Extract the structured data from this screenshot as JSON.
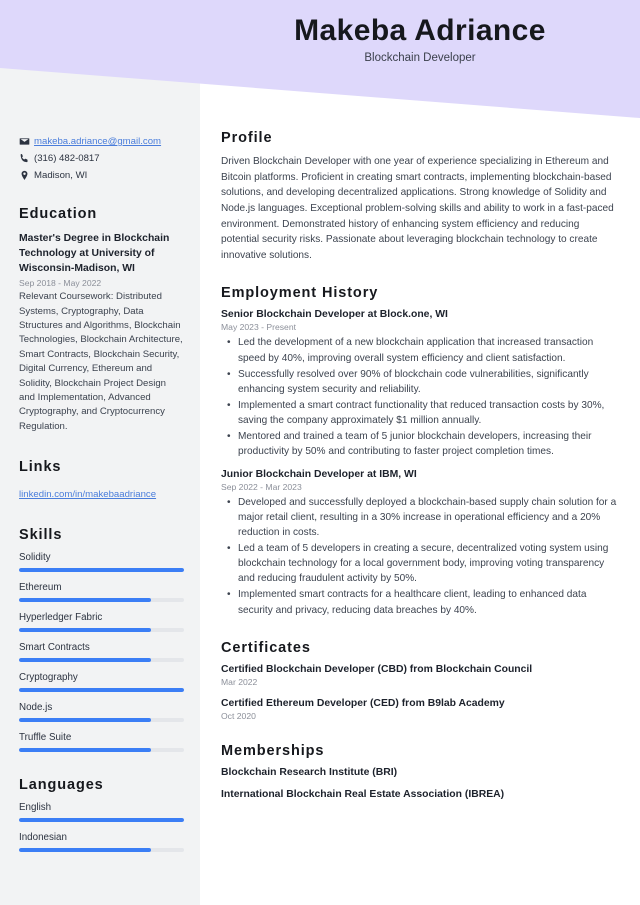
{
  "header": {
    "name": "Makeba Adriance",
    "role": "Blockchain Developer",
    "background_color": "#ded8fb"
  },
  "theme": {
    "sidebar_bg": "#f2f3f4",
    "accent": "#3b7ef5",
    "link_color": "#4a7ddb",
    "track_color": "#e4e6ea"
  },
  "sidebar": {
    "contact": {
      "email": "makeba.adriance@gmail.com",
      "phone": "(316) 482-0817",
      "location": "Madison, WI",
      "email_icon": "envelope-icon",
      "phone_icon": "phone-icon",
      "location_icon": "map-pin-icon"
    },
    "education": {
      "heading": "Education",
      "entries": [
        {
          "title": "Master's Degree in Blockchain Technology at University of Wisconsin-Madison, WI",
          "date": "Sep 2018 - May 2022",
          "description": "Relevant Coursework: Distributed Systems, Cryptography, Data Structures and Algorithms, Blockchain Technologies, Blockchain Architecture, Smart Contracts, Blockchain Security, Digital Currency, Ethereum and Solidity, Blockchain Project Design and Implementation, Advanced Cryptography, and Cryptocurrency Regulation."
        }
      ]
    },
    "links": {
      "heading": "Links",
      "items": [
        {
          "label": "linkedin.com/in/makebaadriance"
        }
      ]
    },
    "skills": {
      "heading": "Skills",
      "items": [
        {
          "label": "Solidity",
          "level": 100
        },
        {
          "label": "Ethereum",
          "level": 80
        },
        {
          "label": "Hyperledger Fabric",
          "level": 80
        },
        {
          "label": "Smart Contracts",
          "level": 80
        },
        {
          "label": "Cryptography",
          "level": 100
        },
        {
          "label": "Node.js",
          "level": 80
        },
        {
          "label": "Truffle Suite",
          "level": 80
        }
      ]
    },
    "languages": {
      "heading": "Languages",
      "items": [
        {
          "label": "English",
          "level": 100
        },
        {
          "label": "Indonesian",
          "level": 80
        }
      ]
    }
  },
  "main": {
    "profile": {
      "heading": "Profile",
      "text": "Driven Blockchain Developer with one year of experience specializing in Ethereum and Bitcoin platforms. Proficient in creating smart contracts, implementing blockchain-based solutions, and developing decentralized applications. Strong knowledge of Solidity and Node.js languages. Exceptional problem-solving skills and ability to work in a fast-paced environment. Demonstrated history of enhancing system efficiency and reducing potential security risks. Passionate about leveraging blockchain technology to create innovative solutions."
    },
    "employment": {
      "heading": "Employment History",
      "jobs": [
        {
          "title": "Senior Blockchain Developer at Block.one, WI",
          "date": "May 2023 - Present",
          "bullets": [
            "Led the development of a new blockchain application that increased transaction speed by 40%, improving overall system efficiency and client satisfaction.",
            "Successfully resolved over 90% of blockchain code vulnerabilities, significantly enhancing system security and reliability.",
            "Implemented a smart contract functionality that reduced transaction costs by 30%, saving the company approximately $1 million annually.",
            "Mentored and trained a team of 5 junior blockchain developers, increasing their productivity by 50% and contributing to faster project completion times."
          ]
        },
        {
          "title": "Junior Blockchain Developer at IBM, WI",
          "date": "Sep 2022 - Mar 2023",
          "bullets": [
            "Developed and successfully deployed a blockchain-based supply chain solution for a major retail client, resulting in a 30% increase in operational efficiency and a 20% reduction in costs.",
            "Led a team of 5 developers in creating a secure, decentralized voting system using blockchain technology for a local government body, improving voting transparency and reducing fraudulent activity by 50%.",
            "Implemented smart contracts for a healthcare client, leading to enhanced data security and privacy, reducing data breaches by 40%."
          ]
        }
      ]
    },
    "certificates": {
      "heading": "Certificates",
      "items": [
        {
          "title": "Certified Blockchain Developer (CBD) from Blockchain Council",
          "date": "Mar 2022"
        },
        {
          "title": "Certified Ethereum Developer (CED) from B9lab Academy",
          "date": "Oct 2020"
        }
      ]
    },
    "memberships": {
      "heading": "Memberships",
      "items": [
        {
          "title": "Blockchain Research Institute (BRI)"
        },
        {
          "title": "International Blockchain Real Estate Association (IBREA)"
        }
      ]
    }
  }
}
